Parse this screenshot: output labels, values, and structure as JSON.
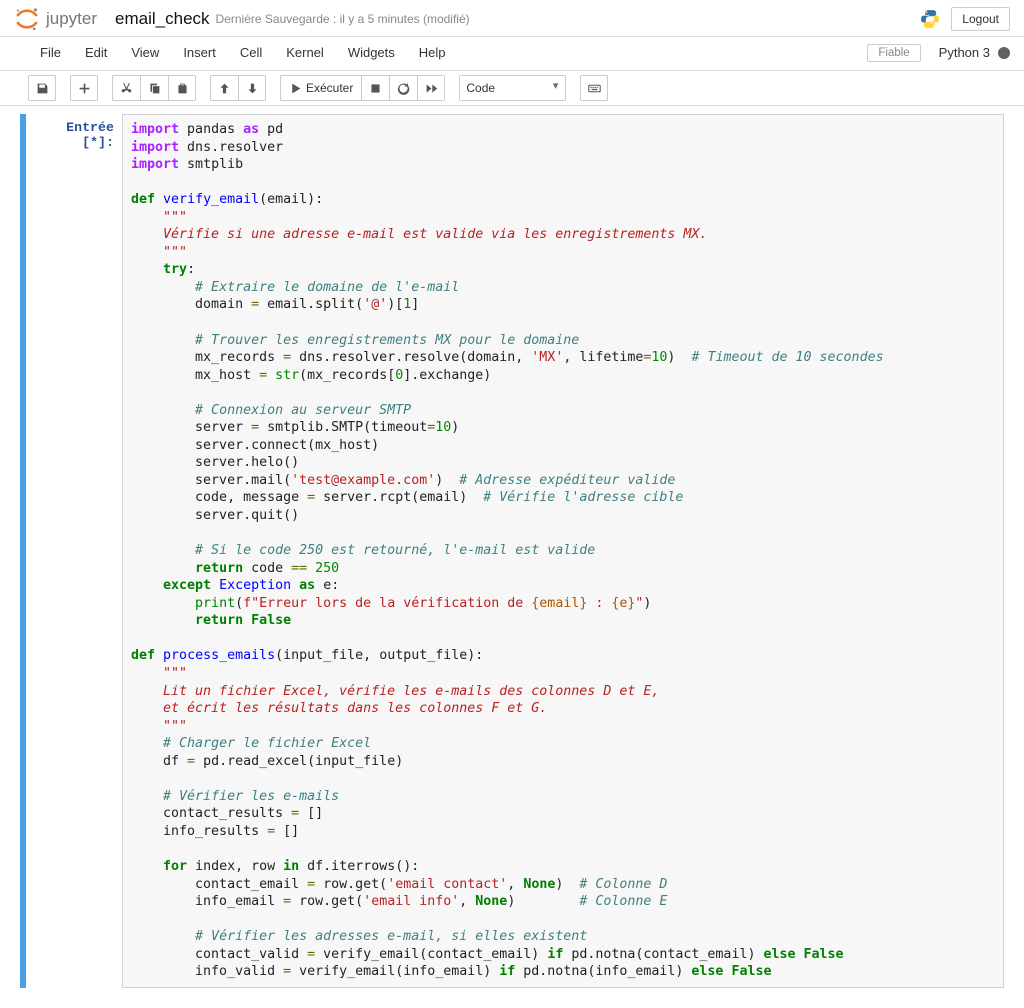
{
  "header": {
    "logo_text": "jupyter",
    "notebook_name": "email_check",
    "save_status": "Dernière Sauvegarde : il y a 5 minutes  (modifié)",
    "logout_label": "Logout"
  },
  "menubar": {
    "items": [
      "File",
      "Edit",
      "View",
      "Insert",
      "Cell",
      "Kernel",
      "Widgets",
      "Help"
    ],
    "trusted_label": "Fiable",
    "kernel_label": "Python 3"
  },
  "toolbar": {
    "run_label": "Exécuter",
    "celltype_selected": "Code"
  },
  "cell": {
    "prompt": "Entrée [*]:",
    "code_plain": "import pandas as pd\nimport dns.resolver\nimport smtplib\n\ndef verify_email(email):\n    \"\"\"\n    Vérifie si une adresse e-mail est valide via les enregistrements MX.\n    \"\"\"\n    try:\n        # Extraire le domaine de l'e-mail\n        domain = email.split('@')[1]\n\n        # Trouver les enregistrements MX pour le domaine\n        mx_records = dns.resolver.resolve(domain, 'MX', lifetime=10)  # Timeout de 10 secondes\n        mx_host = str(mx_records[0].exchange)\n\n        # Connexion au serveur SMTP\n        server = smtplib.SMTP(timeout=10)\n        server.connect(mx_host)\n        server.helo()\n        server.mail('test@example.com')  # Adresse expéditeur valide\n        code, message = server.rcpt(email)  # Vérifie l'adresse cible\n        server.quit()\n\n        # Si le code 250 est retourné, l'e-mail est valide\n        return code == 250\n    except Exception as e:\n        print(f\"Erreur lors de la vérification de {email} : {e}\")\n        return False\n\ndef process_emails(input_file, output_file):\n    \"\"\"\n    Lit un fichier Excel, vérifie les e-mails des colonnes D et E,\n    et écrit les résultats dans les colonnes F et G.\n    \"\"\"\n    # Charger le fichier Excel\n    df = pd.read_excel(input_file)\n\n    # Vérifier les e-mails\n    contact_results = []\n    info_results = []\n\n    for index, row in df.iterrows():\n        contact_email = row.get('email contact', None)  # Colonne D\n        info_email = row.get('email info', None)        # Colonne E\n\n        # Vérifier les adresses e-mail, si elles existent\n        contact_valid = verify_email(contact_email) if pd.notna(contact_email) else False\n        info_valid = verify_email(info_email) if pd.notna(info_email) else False"
  },
  "colors": {
    "accent": "#f37726",
    "link_blue": "#2850a0",
    "running_bar": "#4aa0e6",
    "kernel_dot": "#616161"
  }
}
